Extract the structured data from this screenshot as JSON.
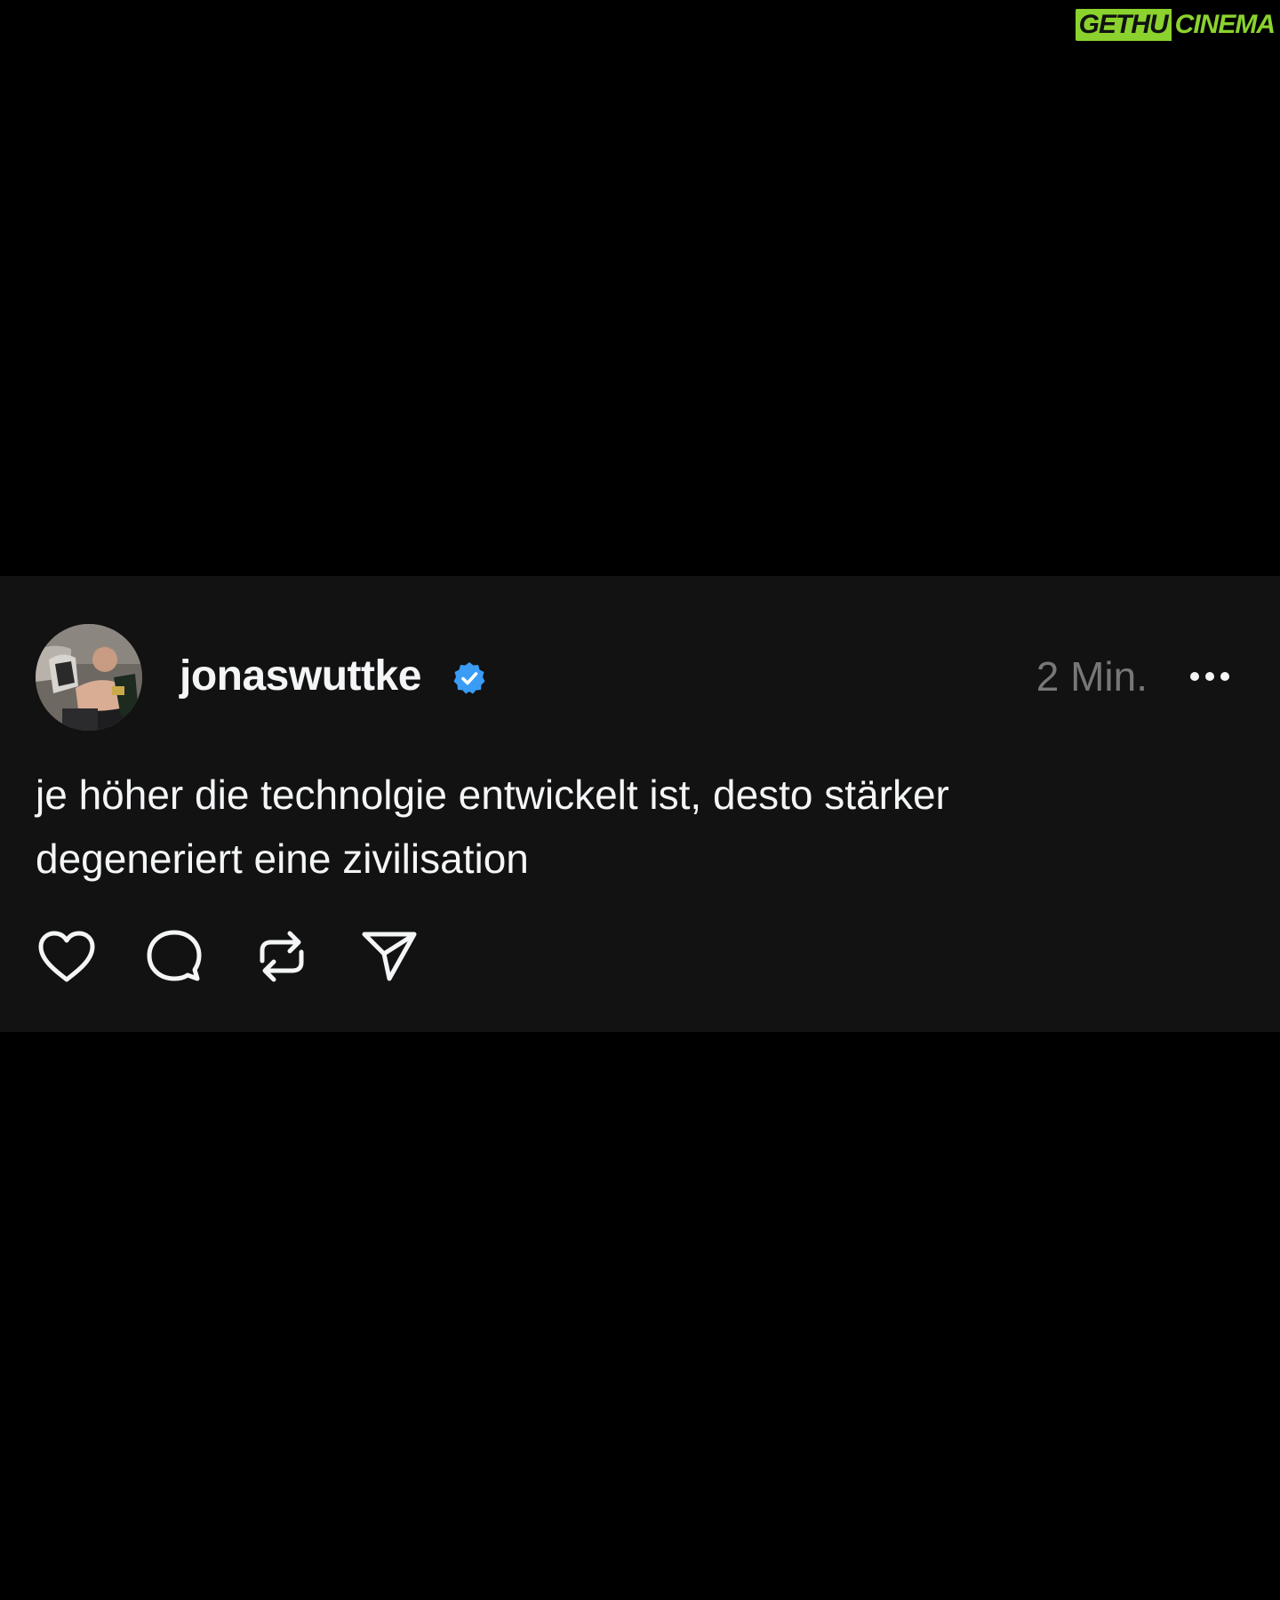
{
  "watermark": {
    "part1": "GETHU",
    "part2": "CINEMA",
    "color": "#8bd22e"
  },
  "post": {
    "username": "jonaswuttke",
    "verified": true,
    "verified_color": "#3b9cf5",
    "timestamp": "2 Min.",
    "text_lines": [
      "je höher die technolgie entwickelt ist, desto stärker",
      "degeneriert eine zivilisation"
    ],
    "icons": {
      "avatar": "avatar-photo",
      "verified": "verified-badge-icon",
      "more": "more-horizontal-icon",
      "like": "heart-icon",
      "reply": "comment-icon",
      "repost": "repost-icon",
      "share": "send-icon"
    }
  },
  "colors": {
    "background": "#000000",
    "card": "#121212",
    "text": "#f3f5f7",
    "muted": "#777777"
  }
}
